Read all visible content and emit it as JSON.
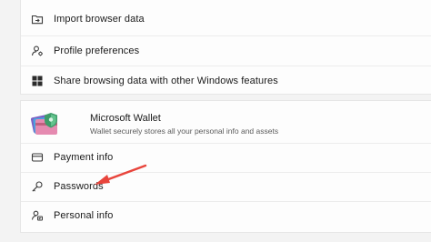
{
  "settings_top": {
    "items": [
      {
        "label": "Import browser data",
        "icon": "folder-import-icon"
      },
      {
        "label": "Profile preferences",
        "icon": "profile-settings-icon"
      },
      {
        "label": "Share browsing data with other Windows features",
        "icon": "windows-icon"
      }
    ]
  },
  "wallet": {
    "title": "Microsoft Wallet",
    "subtitle": "Wallet securely stores all your personal info and assets",
    "icon": "wallet-icon",
    "items": [
      {
        "label": "Payment info",
        "icon": "credit-card-icon"
      },
      {
        "label": "Passwords",
        "icon": "key-icon"
      },
      {
        "label": "Personal info",
        "icon": "person-id-icon"
      }
    ]
  },
  "annotation": {
    "arrow_color": "#e8453c"
  }
}
